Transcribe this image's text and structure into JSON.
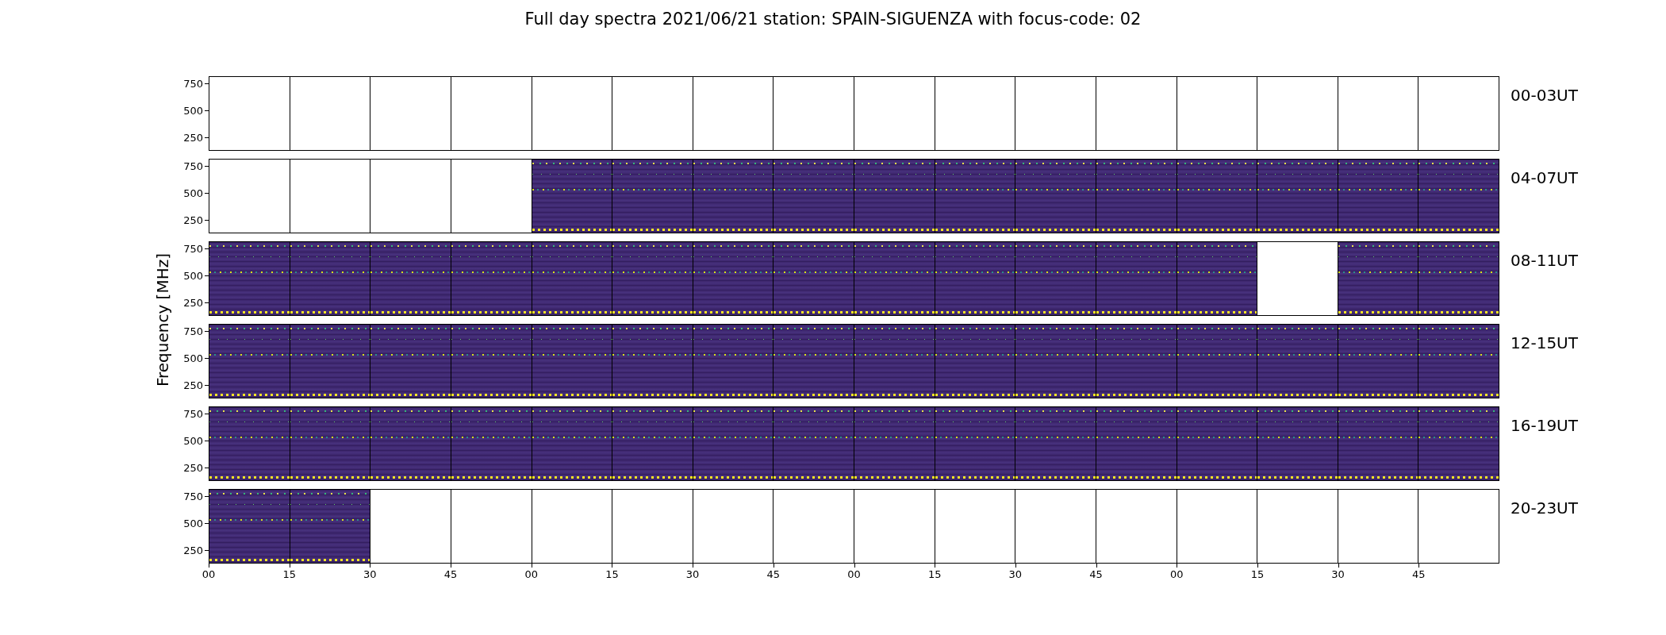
{
  "title": "Full day spectra 2021/06/21 station: SPAIN-SIGUENZA with focus-code: 02",
  "ylabel": "Frequency [MHz]",
  "rows": [
    {
      "label": "00-03UT",
      "yticks": [
        "750",
        "500",
        "250"
      ],
      "panels": [
        {
          "has_data": false
        },
        {
          "has_data": false
        },
        {
          "has_data": false
        },
        {
          "has_data": false
        },
        {
          "has_data": false
        },
        {
          "has_data": false
        },
        {
          "has_data": false
        },
        {
          "has_data": false
        },
        {
          "has_data": false
        },
        {
          "has_data": false
        },
        {
          "has_data": false
        },
        {
          "has_data": false
        },
        {
          "has_data": false
        },
        {
          "has_data": false
        },
        {
          "has_data": false
        },
        {
          "has_data": false
        }
      ]
    },
    {
      "label": "04-07UT",
      "yticks": [
        "750",
        "500",
        "250"
      ],
      "panels": [
        {
          "has_data": false
        },
        {
          "has_data": false
        },
        {
          "has_data": false
        },
        {
          "has_data": false
        },
        {
          "has_data": true
        },
        {
          "has_data": true
        },
        {
          "has_data": true
        },
        {
          "has_data": true
        },
        {
          "has_data": true
        },
        {
          "has_data": true
        },
        {
          "has_data": true
        },
        {
          "has_data": true
        },
        {
          "has_data": true
        },
        {
          "has_data": true
        },
        {
          "has_data": true
        },
        {
          "has_data": true
        }
      ]
    },
    {
      "label": "08-11UT",
      "yticks": [
        "750",
        "500",
        "250"
      ],
      "panels": [
        {
          "has_data": true
        },
        {
          "has_data": true
        },
        {
          "has_data": true
        },
        {
          "has_data": true
        },
        {
          "has_data": true
        },
        {
          "has_data": true
        },
        {
          "has_data": true
        },
        {
          "has_data": true
        },
        {
          "has_data": true
        },
        {
          "has_data": true
        },
        {
          "has_data": true
        },
        {
          "has_data": true
        },
        {
          "has_data": true
        },
        {
          "has_data": false
        },
        {
          "has_data": true
        },
        {
          "has_data": true
        }
      ]
    },
    {
      "label": "12-15UT",
      "yticks": [
        "750",
        "500",
        "250"
      ],
      "panels": [
        {
          "has_data": true
        },
        {
          "has_data": true
        },
        {
          "has_data": true
        },
        {
          "has_data": true
        },
        {
          "has_data": true
        },
        {
          "has_data": true
        },
        {
          "has_data": true
        },
        {
          "has_data": true
        },
        {
          "has_data": true
        },
        {
          "has_data": true
        },
        {
          "has_data": true
        },
        {
          "has_data": true
        },
        {
          "has_data": true
        },
        {
          "has_data": true
        },
        {
          "has_data": true
        },
        {
          "has_data": true
        }
      ]
    },
    {
      "label": "16-19UT",
      "yticks": [
        "750",
        "500",
        "250"
      ],
      "panels": [
        {
          "has_data": true
        },
        {
          "has_data": true
        },
        {
          "has_data": true
        },
        {
          "has_data": true
        },
        {
          "has_data": true
        },
        {
          "has_data": true
        },
        {
          "has_data": true
        },
        {
          "has_data": true
        },
        {
          "has_data": true
        },
        {
          "has_data": true
        },
        {
          "has_data": true
        },
        {
          "has_data": true
        },
        {
          "has_data": true
        },
        {
          "has_data": true
        },
        {
          "has_data": true
        },
        {
          "has_data": true
        }
      ]
    },
    {
      "label": "20-23UT",
      "yticks": [
        "750",
        "500",
        "250"
      ],
      "panels": [
        {
          "has_data": true
        },
        {
          "has_data": true
        },
        {
          "has_data": false
        },
        {
          "has_data": false
        },
        {
          "has_data": false
        },
        {
          "has_data": false
        },
        {
          "has_data": false
        },
        {
          "has_data": false
        },
        {
          "has_data": false
        },
        {
          "has_data": false
        },
        {
          "has_data": false
        },
        {
          "has_data": false
        },
        {
          "has_data": false
        },
        {
          "has_data": false
        },
        {
          "has_data": false
        },
        {
          "has_data": false
        }
      ]
    }
  ],
  "xticks": [
    "00",
    "15",
    "30",
    "45",
    "00",
    "15",
    "30",
    "45",
    "00",
    "15",
    "30",
    "45",
    "00",
    "15",
    "30",
    "45"
  ]
}
